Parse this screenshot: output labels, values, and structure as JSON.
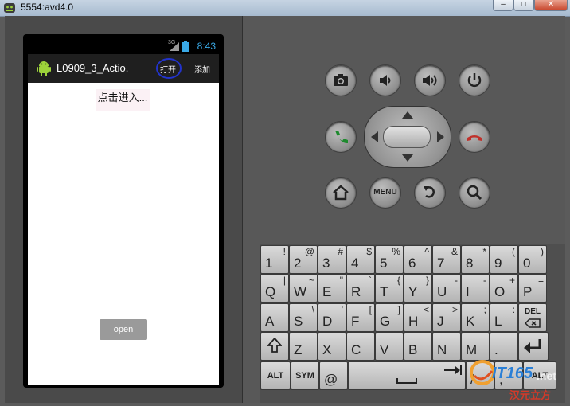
{
  "window": {
    "title": "5554:avd4.0",
    "minimize": "–",
    "maximize": "□",
    "close": "✕"
  },
  "status_bar": {
    "time": "8:43",
    "signal_label": "3G"
  },
  "action_bar": {
    "app_title": "L0909_3_Actio.",
    "items": [
      "打开",
      "添加"
    ]
  },
  "content": {
    "spinner_text": "点击进入...",
    "open_button": "open"
  },
  "controls": {
    "menu_label": "MENU"
  },
  "keyboard": {
    "row1": [
      {
        "m": "1",
        "s": "!"
      },
      {
        "m": "2",
        "s": "@"
      },
      {
        "m": "3",
        "s": "#"
      },
      {
        "m": "4",
        "s": "$"
      },
      {
        "m": "5",
        "s": "%"
      },
      {
        "m": "6",
        "s": "^"
      },
      {
        "m": "7",
        "s": "&"
      },
      {
        "m": "8",
        "s": "*"
      },
      {
        "m": "9",
        "s": "("
      },
      {
        "m": "0",
        "s": ")"
      }
    ],
    "row2": [
      {
        "m": "Q",
        "s": "|"
      },
      {
        "m": "W",
        "s": "~"
      },
      {
        "m": "E",
        "s": "\""
      },
      {
        "m": "R",
        "s": "`"
      },
      {
        "m": "T",
        "s": "{"
      },
      {
        "m": "Y",
        "s": "}"
      },
      {
        "m": "U",
        "s": "-"
      },
      {
        "m": "I",
        "s": "-"
      },
      {
        "m": "O",
        "s": "+"
      },
      {
        "m": "P",
        "s": "="
      }
    ],
    "row3": [
      {
        "m": "A",
        "s": ""
      },
      {
        "m": "S",
        "s": "\\"
      },
      {
        "m": "D",
        "s": "'"
      },
      {
        "m": "F",
        "s": "["
      },
      {
        "m": "G",
        "s": "]"
      },
      {
        "m": "H",
        "s": "<"
      },
      {
        "m": "J",
        "s": ">"
      },
      {
        "m": "K",
        "s": ";"
      },
      {
        "m": "L",
        "s": ":"
      },
      {
        "m": "",
        "s": "",
        "label": "DEL"
      }
    ],
    "row4": [
      {
        "m": "",
        "s": "",
        "icon": "shift"
      },
      {
        "m": "Z",
        "s": ""
      },
      {
        "m": "X",
        "s": ""
      },
      {
        "m": "C",
        "s": ""
      },
      {
        "m": "V",
        "s": ""
      },
      {
        "m": "B",
        "s": ""
      },
      {
        "m": "N",
        "s": ""
      },
      {
        "m": "M",
        "s": ""
      },
      {
        "m": ".",
        "s": ""
      },
      {
        "m": "",
        "s": "",
        "icon": "enter"
      }
    ],
    "row5": {
      "alt_left": "ALT",
      "sym": "SYM",
      "at": "@",
      "slash": "/",
      "comma": ",",
      "alt_right": "ALT"
    }
  },
  "watermark": {
    "main": "IT165",
    "suffix": ".net",
    "sub": "汉元立方"
  },
  "colors": {
    "accent_time": "#3aa9e6",
    "call_green": "#1e8a2e",
    "end_red": "#c0312b"
  }
}
